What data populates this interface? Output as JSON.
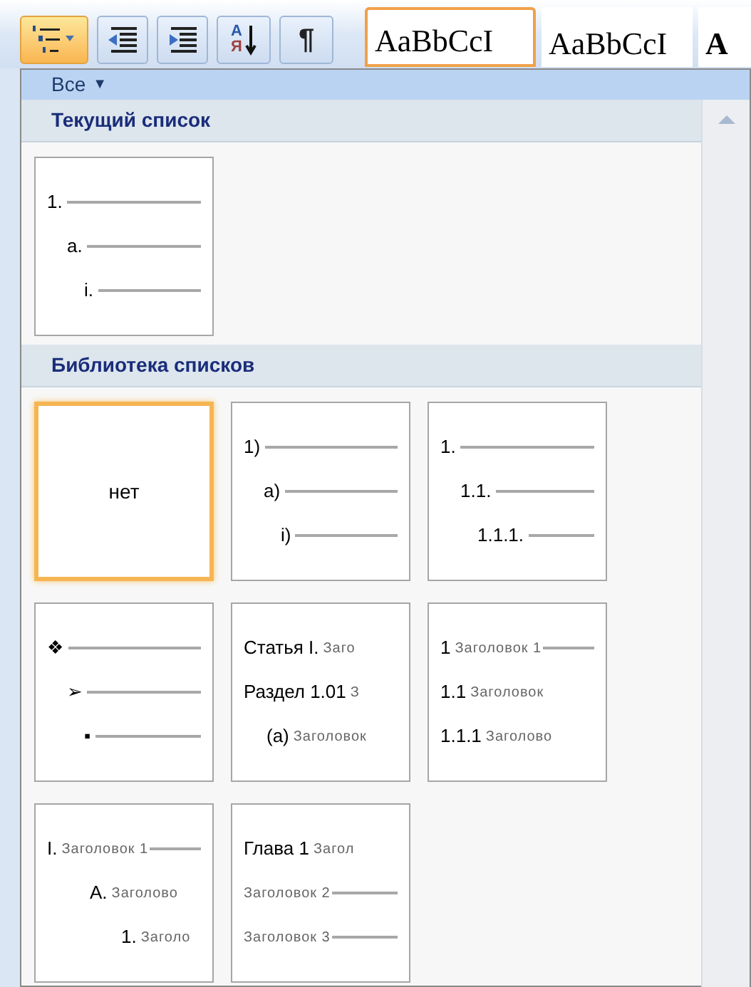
{
  "ribbon": {
    "buttons": [
      {
        "kind": "multilevel",
        "selected": true
      },
      {
        "kind": "outdent",
        "selected": false
      },
      {
        "kind": "indent",
        "selected": false
      },
      {
        "kind": "sort",
        "selected": false,
        "letters": [
          "А",
          "Я"
        ]
      },
      {
        "kind": "pilcrow",
        "selected": false,
        "glyph": "¶"
      }
    ],
    "styles": [
      {
        "sample": "AaBbCcI",
        "selected": true,
        "bold": false
      },
      {
        "sample": "AaBbCcI",
        "selected": false,
        "bold": false
      },
      {
        "sample": "A",
        "selected": false,
        "bold": true
      }
    ]
  },
  "menu": {
    "filter": "Все",
    "filter_arrow": "▼",
    "sections": [
      {
        "title": "Текущий список",
        "rows": [
          {
            "tiles": [
              {
                "kind": "stepped",
                "selected": false,
                "lines": [
                  {
                    "marker": "1.",
                    "rule": true
                  },
                  {
                    "marker": "a.",
                    "rule": true
                  },
                  {
                    "marker": "i.",
                    "rule": true
                  }
                ]
              }
            ]
          }
        ]
      },
      {
        "title": "Библиотека списков",
        "rows": [
          {
            "tiles": [
              {
                "kind": "none",
                "selected": true,
                "label": "нет"
              },
              {
                "kind": "stepped",
                "selected": false,
                "lines": [
                  {
                    "marker": "1)",
                    "rule": true
                  },
                  {
                    "marker": "a)",
                    "rule": true
                  },
                  {
                    "marker": "i)",
                    "rule": true
                  }
                ]
              },
              {
                "kind": "stepped",
                "selected": false,
                "lines": [
                  {
                    "marker": "1.",
                    "rule": true
                  },
                  {
                    "marker": "1.1.",
                    "rule": true
                  },
                  {
                    "marker": "1.1.1.",
                    "rule": true
                  }
                ]
              }
            ]
          },
          {
            "tiles": [
              {
                "kind": "stepped",
                "selected": false,
                "lines": [
                  {
                    "marker": "❖",
                    "rule": true
                  },
                  {
                    "marker": "➢",
                    "rule": true
                  },
                  {
                    "marker": "▪",
                    "rule": true
                  }
                ]
              },
              {
                "kind": "legal",
                "selected": false,
                "lines": [
                  {
                    "marker": "Статья I.",
                    "text": "Заго",
                    "rule": false
                  },
                  {
                    "marker": "Раздел 1.01",
                    "text": "З",
                    "rule": false
                  },
                  {
                    "marker": "(a)",
                    "text": "Заголовок",
                    "rule": false
                  }
                ]
              },
              {
                "kind": "flat",
                "selected": false,
                "lines": [
                  {
                    "marker": "1",
                    "text": "Заголовок 1",
                    "rule": true
                  },
                  {
                    "marker": "1.1",
                    "text": "Заголовок",
                    "rule": false
                  },
                  {
                    "marker": "1.1.1",
                    "text": "Заголово",
                    "rule": false
                  }
                ]
              }
            ]
          },
          {
            "tiles": [
              {
                "kind": "outline",
                "selected": false,
                "lines": [
                  {
                    "marker": "I.",
                    "text": "Заголовок 1",
                    "rule": true
                  },
                  {
                    "marker": "A.",
                    "text": "Заголово",
                    "rule": false
                  },
                  {
                    "marker": "1.",
                    "text": "Заголо",
                    "rule": false
                  }
                ]
              },
              {
                "kind": "flat",
                "selected": false,
                "lines": [
                  {
                    "marker": "Глава 1",
                    "text": "Загол",
                    "rule": false
                  },
                  {
                    "text": "Заголовок 2",
                    "rule": true
                  },
                  {
                    "text": "Заголовок 3",
                    "rule": true
                  }
                ]
              }
            ]
          }
        ]
      }
    ]
  }
}
